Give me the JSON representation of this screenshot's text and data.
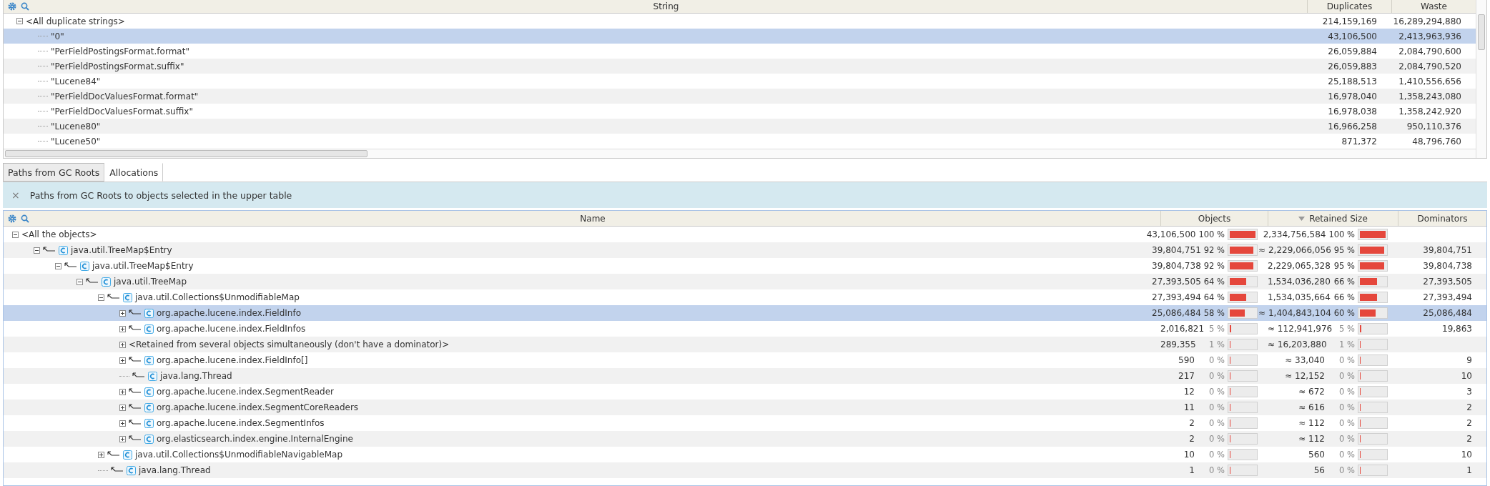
{
  "duplicates_table": {
    "columns": [
      "String",
      "Duplicates",
      "Waste"
    ],
    "rows": [
      {
        "label": "<All duplicate strings>",
        "duplicates": "214,159,169",
        "waste": "16,289,294,880",
        "expanded": true,
        "selected": false,
        "children": [
          {
            "label": "\"0\"",
            "duplicates": "43,106,500",
            "waste": "2,413,963,936",
            "selected": true
          },
          {
            "label": "\"PerFieldPostingsFormat.format\"",
            "duplicates": "26,059,884",
            "waste": "2,084,790,600",
            "selected": false
          },
          {
            "label": "\"PerFieldPostingsFormat.suffix\"",
            "duplicates": "26,059,883",
            "waste": "2,084,790,520",
            "selected": false
          },
          {
            "label": "\"Lucene84\"",
            "duplicates": "25,188,513",
            "waste": "1,410,556,656",
            "selected": false
          },
          {
            "label": "\"PerFieldDocValuesFormat.format\"",
            "duplicates": "16,978,040",
            "waste": "1,358,243,080",
            "selected": false
          },
          {
            "label": "\"PerFieldDocValuesFormat.suffix\"",
            "duplicates": "16,978,038",
            "waste": "1,358,242,920",
            "selected": false
          },
          {
            "label": "\"Lucene80\"",
            "duplicates": "16,966,258",
            "waste": "950,110,376",
            "selected": false
          },
          {
            "label": "\"Lucene50\"",
            "duplicates": "871,372",
            "waste": "48,796,760",
            "selected": false
          }
        ]
      }
    ]
  },
  "tabs": [
    {
      "label": "Paths from GC Roots",
      "selected": true
    },
    {
      "label": "Allocations",
      "selected": false
    }
  ],
  "banner": {
    "close": "×",
    "text": "Paths from GC Roots to objects selected in the upper table"
  },
  "paths_table": {
    "columns": [
      {
        "label": "Name",
        "sorted": false
      },
      {
        "label": "Objects",
        "sorted": false
      },
      {
        "label": "Retained Size",
        "sorted": true
      },
      {
        "label": "Dominators",
        "sorted": false
      }
    ],
    "rows": [
      {
        "kind": "root",
        "label": "<All the objects>",
        "expanded": true,
        "selected": false,
        "objects": "43,106,500",
        "objects_share": {
          "text": "100 %",
          "level": 1
        },
        "retained": "2,334,756,584",
        "retained_share": {
          "text": "100 %",
          "level": 1
        },
        "children": [
          {
            "kind": "reference",
            "label": "java.util.TreeMap$Entry",
            "expanded": true,
            "selected": false,
            "objects": "39,804,751",
            "objects_share": {
              "text": "92 %",
              "level": 0.92
            },
            "retained": "≈ 2,229,066,056",
            "retained_share": {
              "text": "95 %",
              "level": 0.95
            },
            "dominators": "39,804,751",
            "children": [
              {
                "kind": "reference",
                "label": "java.util.TreeMap$Entry",
                "expanded": true,
                "selected": false,
                "objects": "39,804,738",
                "objects_share": {
                  "text": "92 %",
                  "level": 0.92
                },
                "retained": "2,229,065,328",
                "retained_share": {
                  "text": "95 %",
                  "level": 0.95
                },
                "dominators": "39,804,738",
                "children": [
                  {
                    "kind": "reference",
                    "label": "java.util.TreeMap",
                    "expanded": true,
                    "selected": false,
                    "objects": "27,393,505",
                    "objects_share": {
                      "text": "64 %",
                      "level": 0.64
                    },
                    "retained": "1,534,036,280",
                    "retained_share": {
                      "text": "66 %",
                      "level": 0.66
                    },
                    "dominators": "27,393,505",
                    "children": [
                      {
                        "kind": "reference",
                        "label": "java.util.Collections$UnmodifiableMap",
                        "expanded": true,
                        "selected": false,
                        "objects": "27,393,494",
                        "objects_share": {
                          "text": "64 %",
                          "level": 0.64
                        },
                        "retained": "1,534,035,664",
                        "retained_share": {
                          "text": "66 %",
                          "level": 0.66
                        },
                        "dominators": "27,393,494",
                        "children": [
                          {
                            "kind": "reference",
                            "label": "org.apache.lucene.index.FieldInfo",
                            "expanded": false,
                            "selected": true,
                            "objects": "25,086,484",
                            "objects_share": {
                              "text": "58 %",
                              "level": 0.58
                            },
                            "retained": "≈ 1,404,843,104",
                            "retained_share": {
                              "text": "60 %",
                              "level": 0.6
                            },
                            "dominators": "25,086,484"
                          },
                          {
                            "kind": "reference",
                            "label": "org.apache.lucene.index.FieldInfos",
                            "expanded": false,
                            "selected": false,
                            "objects": "2,016,821",
                            "objects_share": {
                              "text": "5 %",
                              "level": 0.05
                            },
                            "retained": "≈ 112,941,976",
                            "retained_share": {
                              "text": "5 %",
                              "level": 0.05
                            },
                            "dominators": "19,863"
                          },
                          {
                            "kind": "group",
                            "label": "<Retained from several objects simultaneously (don't have a dominator)>",
                            "expanded": false,
                            "selected": false,
                            "objects": "289,355",
                            "objects_share": {
                              "text": "1 %",
                              "level": 0.01
                            },
                            "retained": "≈ 16,203,880",
                            "retained_share": {
                              "text": "1 %",
                              "level": 0.01
                            }
                          },
                          {
                            "kind": "reference",
                            "label": "org.apache.lucene.index.FieldInfo[]",
                            "expanded": false,
                            "selected": false,
                            "objects": "590",
                            "objects_share": {
                              "text": "0 %",
                              "level": 0
                            },
                            "retained": "≈ 33,040",
                            "retained_share": {
                              "text": "0 %",
                              "level": 0
                            },
                            "dominators": "9"
                          },
                          {
                            "kind": "reference",
                            "label": "java.lang.Thread",
                            "selected": false,
                            "objects": "217",
                            "objects_share": {
                              "text": "0 %",
                              "level": 0
                            },
                            "retained": "≈ 12,152",
                            "retained_share": {
                              "text": "0 %",
                              "level": 0
                            },
                            "dominators": "10"
                          },
                          {
                            "kind": "reference",
                            "label": "org.apache.lucene.index.SegmentReader",
                            "expanded": false,
                            "selected": false,
                            "objects": "12",
                            "objects_share": {
                              "text": "0 %",
                              "level": 0
                            },
                            "retained": "≈ 672",
                            "retained_share": {
                              "text": "0 %",
                              "level": 0
                            },
                            "dominators": "3"
                          },
                          {
                            "kind": "reference",
                            "label": "org.apache.lucene.index.SegmentCoreReaders",
                            "expanded": false,
                            "selected": false,
                            "objects": "11",
                            "objects_share": {
                              "text": "0 %",
                              "level": 0
                            },
                            "retained": "≈ 616",
                            "retained_share": {
                              "text": "0 %",
                              "level": 0
                            },
                            "dominators": "2"
                          },
                          {
                            "kind": "reference",
                            "label": "org.apache.lucene.index.SegmentInfos",
                            "expanded": false,
                            "selected": false,
                            "objects": "2",
                            "objects_share": {
                              "text": "0 %",
                              "level": 0
                            },
                            "retained": "≈ 112",
                            "retained_share": {
                              "text": "0 %",
                              "level": 0
                            },
                            "dominators": "2"
                          },
                          {
                            "kind": "reference",
                            "label": "org.elasticsearch.index.engine.InternalEngine",
                            "expanded": false,
                            "selected": false,
                            "objects": "2",
                            "objects_share": {
                              "text": "0 %",
                              "level": 0
                            },
                            "retained": "≈ 112",
                            "retained_share": {
                              "text": "0 %",
                              "level": 0
                            },
                            "dominators": "2"
                          }
                        ]
                      },
                      {
                        "kind": "reference",
                        "label": "java.util.Collections$UnmodifiableNavigableMap",
                        "expanded": false,
                        "selected": false,
                        "objects": "10",
                        "objects_share": {
                          "text": "0 %",
                          "level": 0
                        },
                        "retained": "560",
                        "retained_share": {
                          "text": "0 %",
                          "level": 0
                        },
                        "dominators": "10"
                      },
                      {
                        "kind": "reference",
                        "label": "java.lang.Thread",
                        "selected": false,
                        "objects": "1",
                        "objects_share": {
                          "text": "0 %",
                          "level": 0
                        },
                        "retained": "56",
                        "retained_share": {
                          "text": "0 %",
                          "level": 0
                        },
                        "dominators": "1"
                      }
                    ]
                  }
                ]
              }
            ]
          }
        ]
      }
    ]
  }
}
